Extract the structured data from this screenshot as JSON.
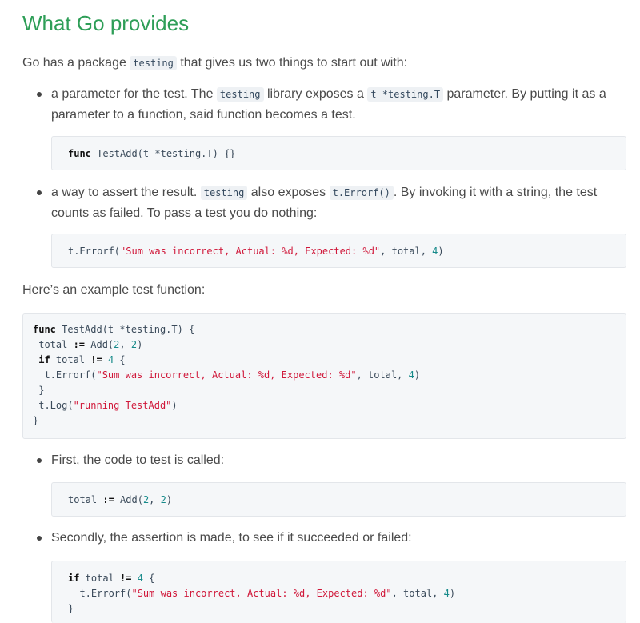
{
  "heading": "What Go provides",
  "intro": {
    "before": "Go has a package ",
    "code": "testing",
    "after": " that gives us two things to start out with:"
  },
  "bullet1": {
    "t1": "a parameter for the test. The ",
    "c1": "testing",
    "t2": " library exposes a ",
    "c2": "t *testing.T",
    "t3": " parameter. By putting it as a parameter to a function, said function becomes a test."
  },
  "code1": {
    "kw": "func",
    "rest": " TestAdd(t *testing.T) {}"
  },
  "bullet2": {
    "t1": "a way to assert the result. ",
    "c1": "testing",
    "t2": " also exposes ",
    "c2": "t.Errorf()",
    "t3": ". By invoking it with a string, the test counts as failed. To pass a test you do nothing:"
  },
  "code2": {
    "a": "t.Errorf(",
    "s": "\"Sum was incorrect, Actual: %d, Expected: %d\"",
    "b": ", total, ",
    "n": "4",
    "c": ")"
  },
  "example_intro": "Here’s an example test function:",
  "code3": {
    "l1_kw": "func",
    "l1_rest": " TestAdd(t *testing.T) {",
    "l2_a": " total ",
    "l2_op": ":=",
    "l2_b": " Add(",
    "l2_n1": "2",
    "l2_c": ", ",
    "l2_n2": "2",
    "l2_d": ")",
    "l3_kw": " if",
    "l3_a": " total ",
    "l3_op": "!=",
    "l3_b": " ",
    "l3_n": "4",
    "l3_c": " {",
    "l4_a": "  t.Errorf(",
    "l4_s": "\"Sum was incorrect, Actual: %d, Expected: %d\"",
    "l4_b": ", total, ",
    "l4_n": "4",
    "l4_c": ")",
    "l5": " }",
    "l6_a": " t.Log(",
    "l6_s": "\"running TestAdd\"",
    "l6_c": ")",
    "l7": "}"
  },
  "bullet3": "First, the code to test is called:",
  "code4": {
    "a": "total ",
    "op": ":=",
    "b": " Add(",
    "n1": "2",
    "c": ", ",
    "n2": "2",
    "d": ")"
  },
  "bullet4": "Secondly, the assertion is made, to see if it succeeded or failed:",
  "code5": {
    "l1_kw": "if",
    "l1_a": " total ",
    "l1_op": "!=",
    "l1_b": " ",
    "l1_n": "4",
    "l1_c": " {",
    "l2_a": "  t.Errorf(",
    "l2_s": "\"Sum was incorrect, Actual: %d, Expected: %d\"",
    "l2_b": ", total, ",
    "l2_n": "4",
    "l2_c": ")",
    "l3": "}"
  }
}
